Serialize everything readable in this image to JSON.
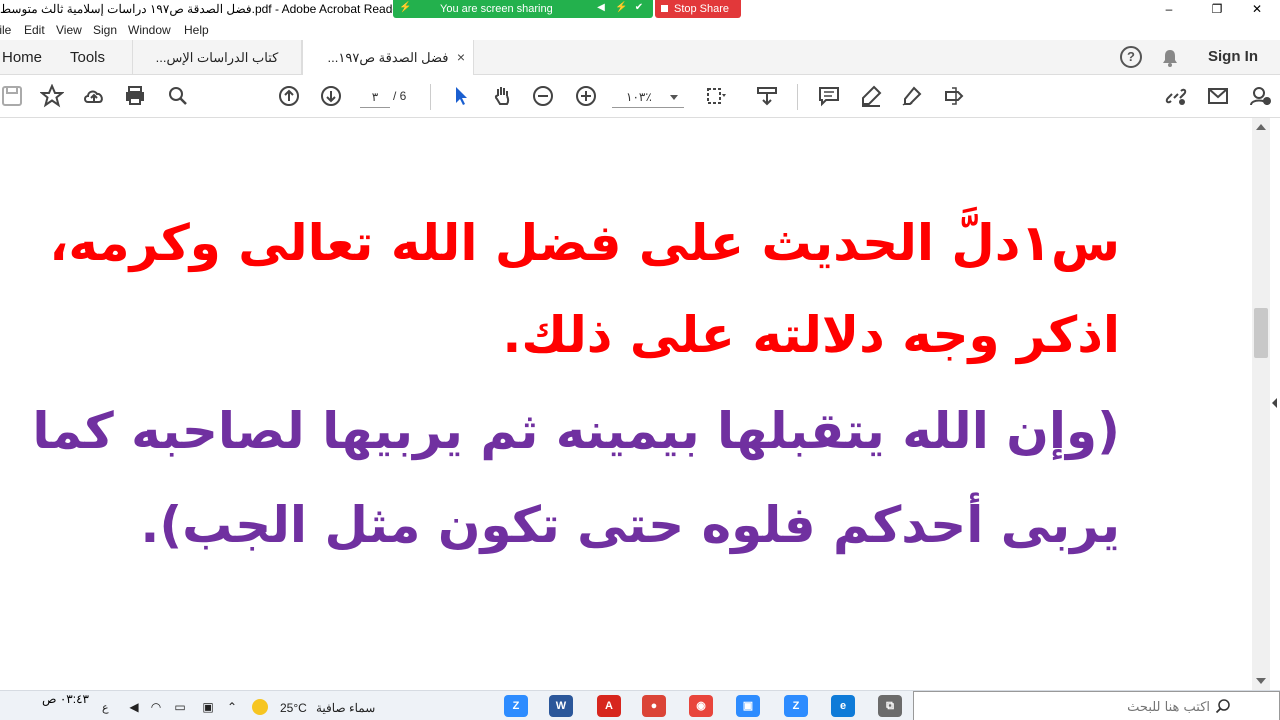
{
  "window": {
    "title": "فضل الصدقة ص١٩٧ دراسات إسلامية ثالث متوسط.pdf - Adobe Acrobat Reader DC",
    "share_text": "You are screen sharing",
    "stop_share_label": "Stop Share",
    "minimize": "–",
    "maximize": "❐",
    "close": "✕"
  },
  "menu": [
    "File",
    "Edit",
    "View",
    "Sign",
    "Window",
    "Help"
  ],
  "tabs": {
    "home": "Home",
    "tools": "Tools",
    "docs": [
      {
        "label": "كتاب الدراسات الإس...",
        "close": ""
      },
      {
        "label": "فضل الصدقة ص١٩٧...",
        "close": "×"
      }
    ],
    "sign_in": "Sign In",
    "help_icon": "?"
  },
  "toolbar": {
    "page_current": "٣",
    "page_total": "/  6",
    "zoom": "١٠٣٪"
  },
  "document": {
    "question_lines": [
      "س١دلَّ الحديث على فضل الله تعالى وكرمه،",
      "اذكر وجه دلالته على ذلك."
    ],
    "answer_lines": [
      "(وإن الله يتقبلها بيمينه ثم يربيها لصاحبه كما",
      "يربى أحدكم فلوه حتى تكون مثل الجب)."
    ]
  },
  "taskbar": {
    "time": "٠٣:٤٣ ص",
    "date": "",
    "lang": "ع",
    "temperature": "25°C",
    "weather": "سماء صافية",
    "search_placeholder": "اكتب هنا للبحث",
    "apps": [
      {
        "name": "zoom-app-icon",
        "label": "Z",
        "color": "#2d8cff"
      },
      {
        "name": "word-app-icon",
        "label": "W",
        "color": "#2b579a"
      },
      {
        "name": "acrobat-app-icon",
        "label": "A",
        "color": "#d7261e"
      },
      {
        "name": "chrome-app-icon",
        "label": "●",
        "color": "#db4437"
      },
      {
        "name": "record-app-icon",
        "label": "◉",
        "color": "#e8453c"
      },
      {
        "name": "meet-app-icon",
        "label": "▣",
        "color": "#2d8cff"
      },
      {
        "name": "zoom2-app-icon",
        "label": "Z",
        "color": "#2d8cff"
      },
      {
        "name": "edge-app-icon",
        "label": "e",
        "color": "#0f7bd8"
      },
      {
        "name": "taskview-app-icon",
        "label": "⧉",
        "color": "#6b6b6b"
      }
    ]
  }
}
